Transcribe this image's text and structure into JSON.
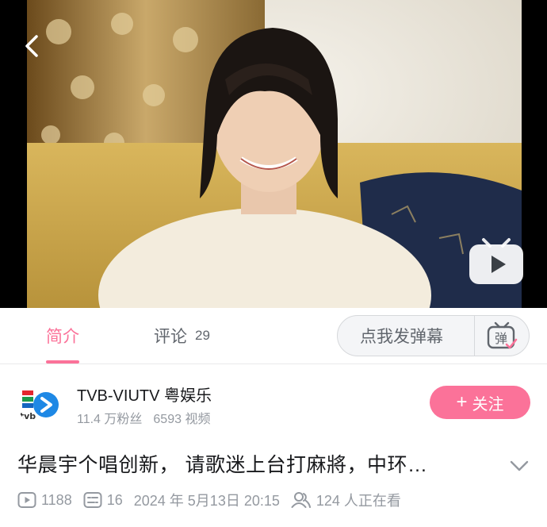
{
  "player": {
    "back_icon": "chevron-left-icon",
    "play_icon": "tv-play-icon"
  },
  "tabs": {
    "intro_label": "简介",
    "comments_label": "评论",
    "comments_count": "29",
    "active": "intro"
  },
  "danmaku": {
    "placeholder": "点我发弹幕",
    "toggle_glyph": "弹",
    "toggle_icon": "danmaku-tv-icon"
  },
  "uploader": {
    "name": "TVB-VIUTV 粤娱乐",
    "fans": "11.4 万粉丝",
    "videos": "6593 视频",
    "avatar_text": "tvb",
    "follow_label": "关注",
    "follow_plus": "+"
  },
  "video": {
    "title": "华晨宇个唱创新， 请歌迷上台打麻將，中环…",
    "plays": "1188",
    "danmaku_count": "16",
    "date": "2024 年 5月13日 20:15",
    "watching": "124 人正在看"
  },
  "colors": {
    "accent": "#fb7299",
    "secondary_text": "#9499a0",
    "primary_text": "#18191c"
  }
}
